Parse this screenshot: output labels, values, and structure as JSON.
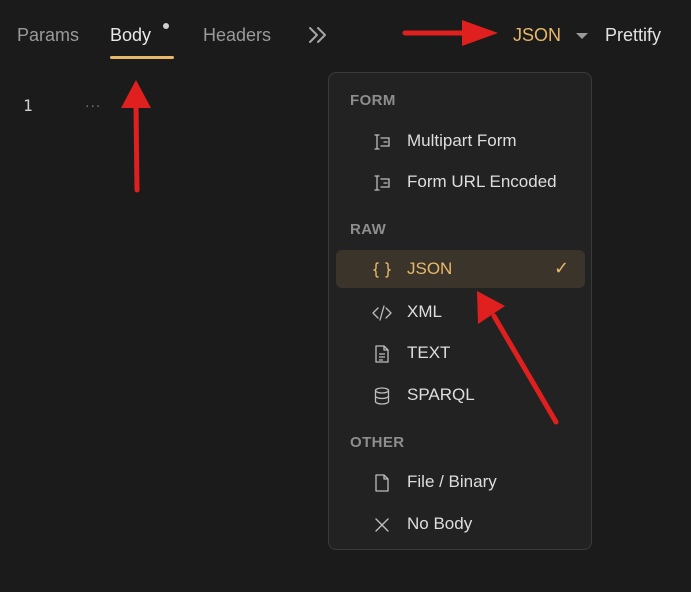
{
  "tabs": [
    {
      "label": "Params"
    },
    {
      "label": "Body"
    },
    {
      "label": "Headers"
    }
  ],
  "toolbar": {
    "body_type": "JSON",
    "prettify_label": "Prettify",
    "more_icon": "chevrons-right-icon"
  },
  "editor": {
    "line_number": "1",
    "placeholder": "..."
  },
  "menu": {
    "sections": [
      {
        "title": "FORM",
        "items": [
          {
            "label": "Multipart Form",
            "icon": "text-cursor-box-icon"
          },
          {
            "label": "Form URL Encoded",
            "icon": "text-cursor-box-icon"
          }
        ]
      },
      {
        "title": "RAW",
        "items": [
          {
            "label": "JSON",
            "icon": "curly-braces-icon",
            "selected": true,
            "check": "✓"
          },
          {
            "label": "XML",
            "icon": "code-icon"
          },
          {
            "label": "TEXT",
            "icon": "document-icon"
          },
          {
            "label": "SPARQL",
            "icon": "database-icon"
          }
        ]
      },
      {
        "title": "OTHER",
        "items": [
          {
            "label": "File / Binary",
            "icon": "file-icon"
          },
          {
            "label": "No Body",
            "icon": "x-icon"
          }
        ]
      }
    ]
  },
  "colors": {
    "accent": "#e8b86a",
    "annotation_arrow": "#e0201e",
    "background": "#1b1b1b",
    "menu_background": "#222222",
    "selected_background": "#3b342a"
  }
}
